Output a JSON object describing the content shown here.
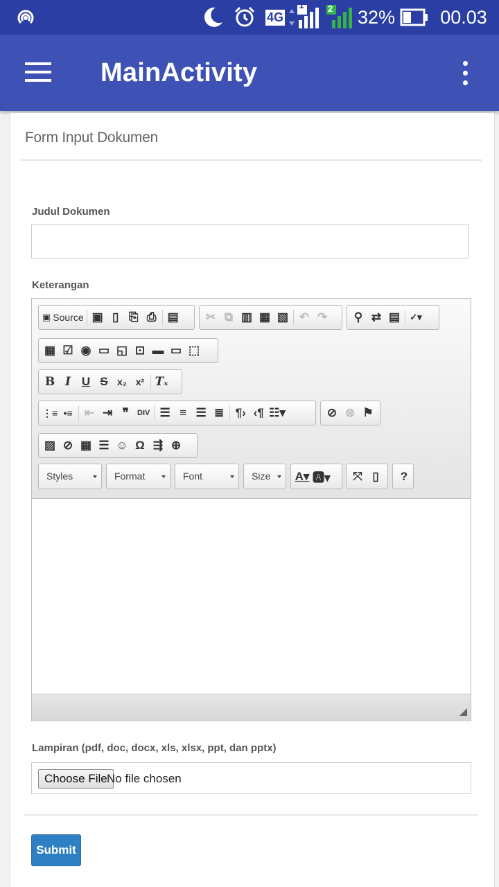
{
  "status_bar": {
    "network": "4G",
    "sim1": "1",
    "sim2": "2",
    "battery": "32%",
    "time": "00.03",
    "icons": [
      "wifi-hotspot-icon",
      "moon-icon",
      "alarm-icon",
      "signal-icon",
      "battery-icon"
    ]
  },
  "app_bar": {
    "title": "MainActivity",
    "icons": [
      "hamburger-menu-icon",
      "overflow-menu-icon"
    ],
    "color": "#3e51b5"
  },
  "form": {
    "title": "Form Input Dokumen",
    "judul_label": "Judul Dokumen",
    "judul_value": "",
    "keterangan_label": "Keterangan",
    "source_label": "Source",
    "combos": {
      "styles": "Styles",
      "format": "Format",
      "font": "Font",
      "size": "Size"
    },
    "lampiran_label": "Lampiran (pdf, doc, docx, xls, xlsx, ppt, dan pptx)",
    "choose_file_label": "Choose File",
    "no_file_text": "No file chosen",
    "submit_label": "Submit",
    "submit_color": "#2f80c2"
  }
}
